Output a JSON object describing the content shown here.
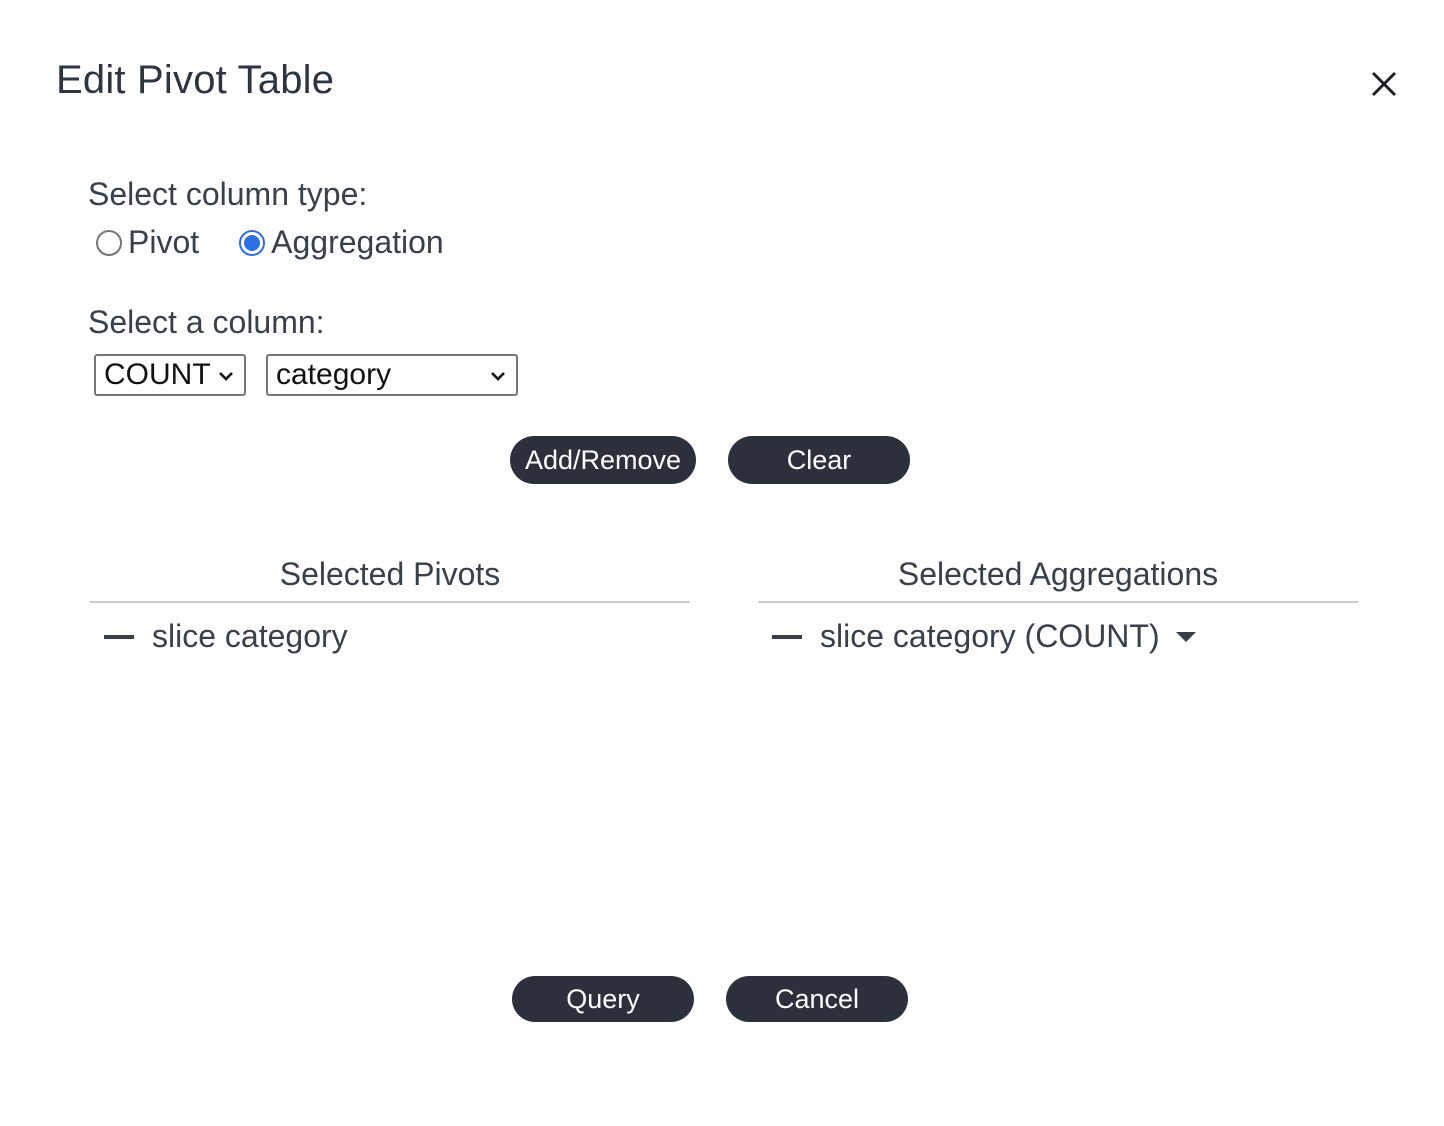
{
  "dialog": {
    "title": "Edit Pivot Table"
  },
  "column_type": {
    "label": "Select column type:",
    "options": [
      {
        "label": "Pivot",
        "checked": false
      },
      {
        "label": "Aggregation",
        "checked": true
      }
    ]
  },
  "column_select": {
    "label": "Select a column:",
    "aggregation_value": "COUNT",
    "column_value": "category"
  },
  "actions": {
    "add_remove_label": "Add/Remove",
    "clear_label": "Clear"
  },
  "selected_pivots": {
    "header": "Selected Pivots",
    "items": [
      "slice category"
    ]
  },
  "selected_aggregations": {
    "header": "Selected Aggregations",
    "items": [
      "slice category (COUNT)"
    ]
  },
  "footer": {
    "query_label": "Query",
    "cancel_label": "Cancel"
  },
  "colors": {
    "button_bg": "#2b303b",
    "radio_accent": "#2f6fe6",
    "text": "#3a4049"
  },
  "icons": {
    "close": "close-icon",
    "dropdown": "chevron-down-icon",
    "remove": "minus-icon",
    "caret": "caret-down-icon"
  }
}
